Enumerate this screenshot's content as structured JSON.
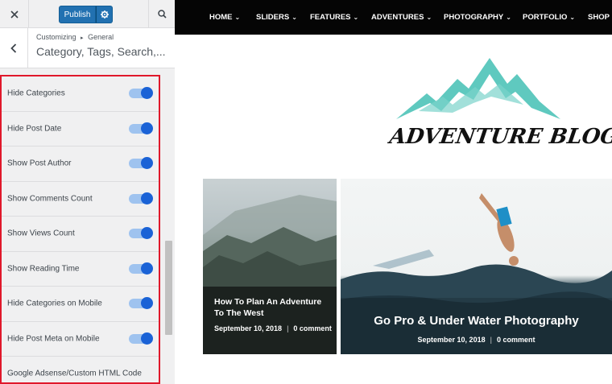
{
  "topbar": {
    "publish_label": "Publish"
  },
  "section": {
    "breadcrumb_root": "Customizing",
    "breadcrumb_sep": "▸",
    "breadcrumb_parent": "General",
    "title": "Category, Tags, Search,..."
  },
  "options": [
    {
      "label": "Hide Categories",
      "enabled": true
    },
    {
      "label": "Hide Post Date",
      "enabled": true
    },
    {
      "label": "Show Post Author",
      "enabled": true
    },
    {
      "label": "Show Comments Count",
      "enabled": true
    },
    {
      "label": "Show Views Count",
      "enabled": true
    },
    {
      "label": "Show Reading Time",
      "enabled": true
    },
    {
      "label": "Hide Categories on Mobile",
      "enabled": true
    },
    {
      "label": "Hide Post Meta on Mobile",
      "enabled": true
    },
    {
      "label": "Google Adsense/Custom HTML Code"
    }
  ],
  "nav": {
    "items": [
      "HOME",
      "SLIDERS",
      "FEATURES",
      "ADVENTURES",
      "PHOTOGRAPHY",
      "PORTFOLIO",
      "SHOP"
    ]
  },
  "logo": {
    "text": "ADVENTURE BLOG"
  },
  "posts": [
    {
      "title": "How To Plan An Adventure To The West",
      "date": "September 10, 2018",
      "sep": "|",
      "comments": "0 comment"
    },
    {
      "title": "Go Pro & Under Water Photography",
      "date": "September 10, 2018",
      "sep": "|",
      "comments": "0 comment"
    }
  ],
  "colors": {
    "accent": "#2271b1",
    "toggle_on": "#1a62d6",
    "highlight": "#e0182b",
    "logo_mountain": "#5fc9bf"
  }
}
